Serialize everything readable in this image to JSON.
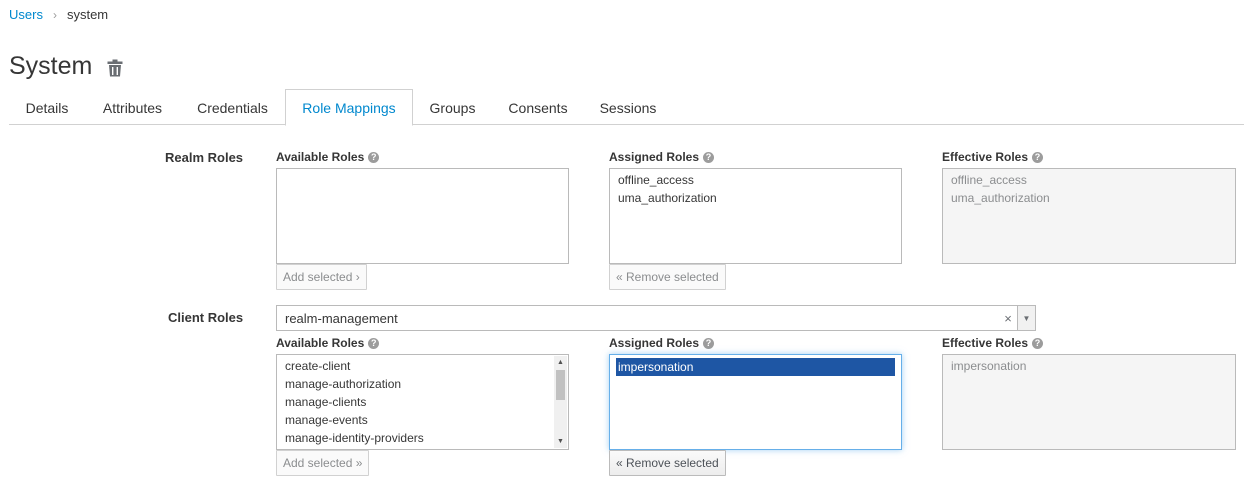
{
  "breadcrumb": {
    "parent": "Users",
    "separator": "›",
    "current": "system"
  },
  "page": {
    "title": "System"
  },
  "tabs": [
    {
      "label": "Details"
    },
    {
      "label": "Attributes"
    },
    {
      "label": "Credentials"
    },
    {
      "label": "Role Mappings"
    },
    {
      "label": "Groups"
    },
    {
      "label": "Consents"
    },
    {
      "label": "Sessions"
    }
  ],
  "realm_roles": {
    "label": "Realm Roles",
    "available_label": "Available Roles",
    "assigned_label": "Assigned Roles",
    "effective_label": "Effective Roles",
    "available": [],
    "assigned": [
      "offline_access",
      "uma_authorization"
    ],
    "effective": [
      "offline_access",
      "uma_authorization"
    ],
    "add_button": "Add selected ›",
    "remove_button": "« Remove selected"
  },
  "client_roles": {
    "label": "Client Roles",
    "client_select": {
      "value": "realm-management",
      "clear": "×",
      "arrow": "▼"
    },
    "available_label": "Available Roles",
    "assigned_label": "Assigned Roles",
    "effective_label": "Effective Roles",
    "available": [
      "create-client",
      "manage-authorization",
      "manage-clients",
      "manage-events",
      "manage-identity-providers"
    ],
    "assigned": [
      "impersonation"
    ],
    "effective": [
      "impersonation"
    ],
    "add_button": "Add selected »",
    "remove_button": "« Remove selected"
  },
  "help_glyph": "?",
  "scroll": {
    "up": "▲",
    "down": "▼"
  },
  "colors": {
    "link": "#0088ce",
    "selected": "#1e56a4",
    "focus": "#66afe9"
  }
}
